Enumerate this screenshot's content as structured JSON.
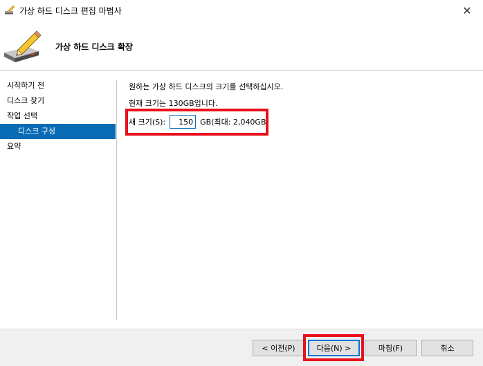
{
  "window": {
    "title": "가상 하드 디스크 편집 마법사",
    "close_glyph": "✕"
  },
  "header": {
    "title": "가상 하드 디스크 확장"
  },
  "nav": {
    "items": [
      {
        "label": "시작하기 전"
      },
      {
        "label": "디스크 찾기"
      },
      {
        "label": "작업 선택"
      },
      {
        "label": "디스크 구성",
        "selected": true
      },
      {
        "label": "요약"
      }
    ]
  },
  "content": {
    "description": "원하는 가상 하드 디스크의 크기를 선택하십시오.",
    "current_size": "현재 크기는 130GB입니다.",
    "new_size_label": "새 크기(S):",
    "new_size_value": "150",
    "max_text": "GB(최대: 2,040GB)"
  },
  "buttons": {
    "back": "< 이전(P)",
    "next": "다음(N) >",
    "finish": "마침(F)",
    "cancel": "취소"
  },
  "colors": {
    "selection": "#0a6bb5",
    "highlight": "#e8101c",
    "default_button_border": "#0078d7"
  },
  "icons": {
    "title": "disk-edit-icon",
    "header": "disk-pencil-icon",
    "close": "close-icon"
  }
}
